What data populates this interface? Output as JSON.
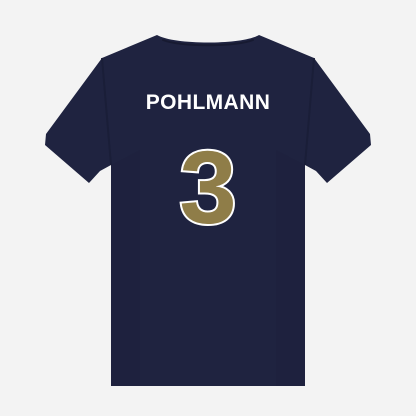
{
  "product": {
    "player_name": "POHLMANN",
    "player_number": "3",
    "view": "back"
  },
  "colors": {
    "background": "#f3f3f3",
    "shirt": "#1f2340",
    "shirt_shadow": "#171a31",
    "name_text": "#ffffff",
    "number_fill": "#8f7d48",
    "number_outline": "#ffffff"
  }
}
